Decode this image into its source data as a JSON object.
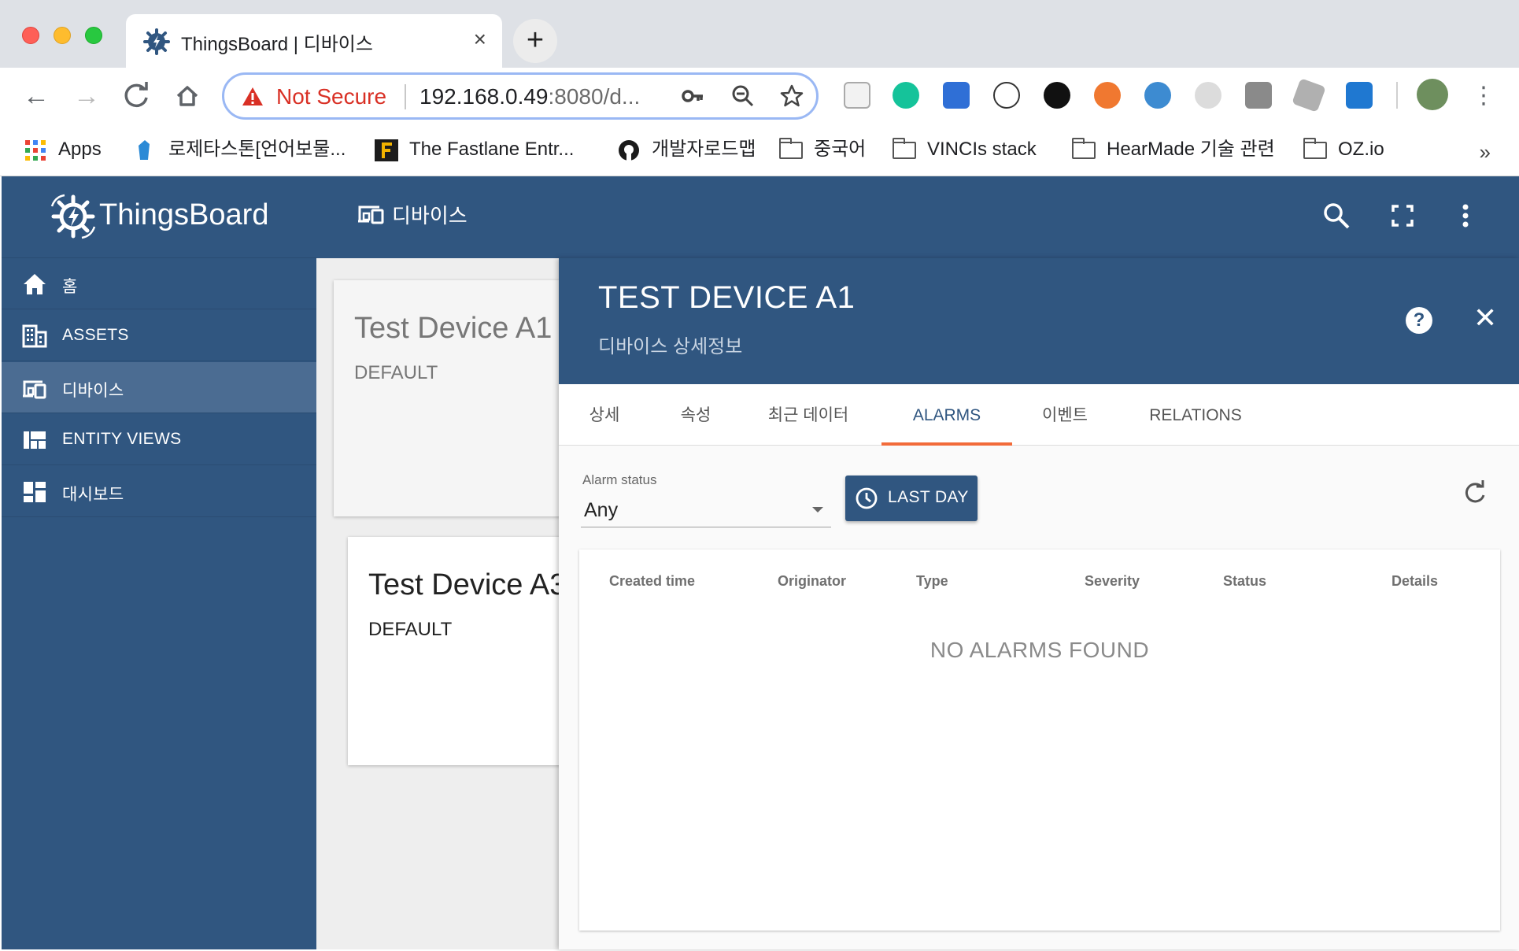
{
  "browser": {
    "tab_title": "ThingsBoard | 디바이스",
    "new_tab_label": "+",
    "close_tab_label": "×",
    "security_label": "Not Secure",
    "url_host": "192.168.0.49",
    "url_rest": ":8080/d...",
    "more_bookmarks": "»",
    "bookmarks": [
      {
        "label": "Apps"
      },
      {
        "label": "로제타스톤[언어보물..."
      },
      {
        "label": "The Fastlane Entr..."
      },
      {
        "label": "개발자로드맵"
      },
      {
        "label": "중국어"
      },
      {
        "label": "VINCIs stack"
      },
      {
        "label": "HearMade 기술 관련"
      },
      {
        "label": "OZ.io"
      }
    ]
  },
  "app": {
    "brand": "ThingsBoard",
    "page_title": "디바이스",
    "sidebar": {
      "items": [
        {
          "label": "홈",
          "icon": "home-icon"
        },
        {
          "label": "ASSETS",
          "icon": "building-icon"
        },
        {
          "label": "디바이스",
          "icon": "devices-icon",
          "active": true
        },
        {
          "label": "ENTITY VIEWS",
          "icon": "view-quilt-icon"
        },
        {
          "label": "대시보드",
          "icon": "dashboard-icon"
        }
      ]
    },
    "cards": [
      {
        "title": "Test Device A1",
        "type": "DEFAULT"
      },
      {
        "title": "Test Device A3",
        "type": "DEFAULT"
      }
    ],
    "detail": {
      "title": "TEST DEVICE A1",
      "subtitle": "디바이스 상세정보",
      "help_label": "?",
      "close_label": "✕",
      "tabs": [
        {
          "label": "상세"
        },
        {
          "label": "속성"
        },
        {
          "label": "최근 데이터"
        },
        {
          "label": "ALARMS",
          "active": true
        },
        {
          "label": "이벤트"
        },
        {
          "label": "RELATIONS"
        }
      ],
      "alarm_filter": {
        "label": "Alarm status",
        "value": "Any"
      },
      "time_button": "LAST DAY",
      "table": {
        "columns": [
          "Created time",
          "Originator",
          "Type",
          "Severity",
          "Status",
          "Details"
        ],
        "empty_message": "NO ALARMS FOUND"
      }
    },
    "colors": {
      "primary": "#305680",
      "accent": "#f26b3a",
      "danger": "#d93025"
    }
  }
}
